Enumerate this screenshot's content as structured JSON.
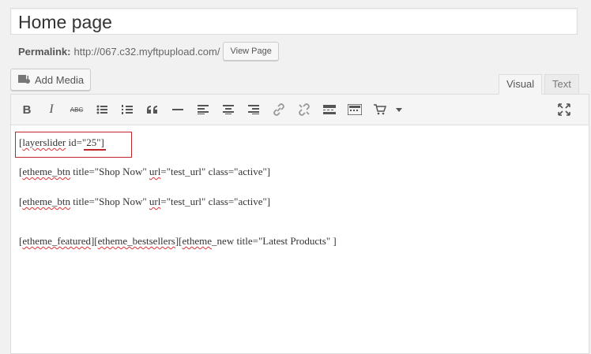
{
  "post": {
    "title": "Home page",
    "permalink_label": "Permalink:",
    "permalink_url": "http://067.c32.myftpupload.com/",
    "view_page_label": "View Page"
  },
  "media": {
    "add_media_label": "Add Media"
  },
  "tabs": {
    "visual": "Visual",
    "text": "Text"
  },
  "toolbar": {
    "buttons": [
      "bold-icon",
      "italic-icon",
      "strikethrough-icon",
      "bullet-list-icon",
      "numbered-list-icon",
      "blockquote-icon",
      "horizontal-rule-icon",
      "align-left-icon",
      "align-center-icon",
      "align-right-icon",
      "insert-link-icon",
      "remove-link-icon",
      "read-more-icon",
      "toolbar-toggle-icon",
      "cart-icon",
      "dropdown-icon",
      "fullscreen-icon"
    ],
    "bold": "B",
    "italic": "I",
    "strike": "ABC"
  },
  "content": {
    "line1_a": "[",
    "line1_b": "layerslider",
    "line1_c": " id=\"",
    "line1_d": "25",
    "line1_e": "\"]",
    "line2_a": "[",
    "line2_b": "etheme_btn",
    "line2_c": " title=\"Shop Now\" ",
    "line2_d": "url",
    "line2_e": "=\"test_url\" class=\"active\"]",
    "line3_a": "[",
    "line3_b": "etheme_btn",
    "line3_c": " title=\"Shop Now\" ",
    "line3_d": "url",
    "line3_e": "=\"test_url\" class=\"active\"]",
    "line4_a": "[",
    "line4_b": "etheme_featured",
    "line4_c": "][",
    "line4_d": "etheme_bestsellers",
    "line4_e": "][",
    "line4_f": "etheme",
    "line4_g": "_new title=\"Latest Products\" ]"
  },
  "colors": {
    "highlight": "#c0252e",
    "spellcheck": "#dd3333"
  }
}
